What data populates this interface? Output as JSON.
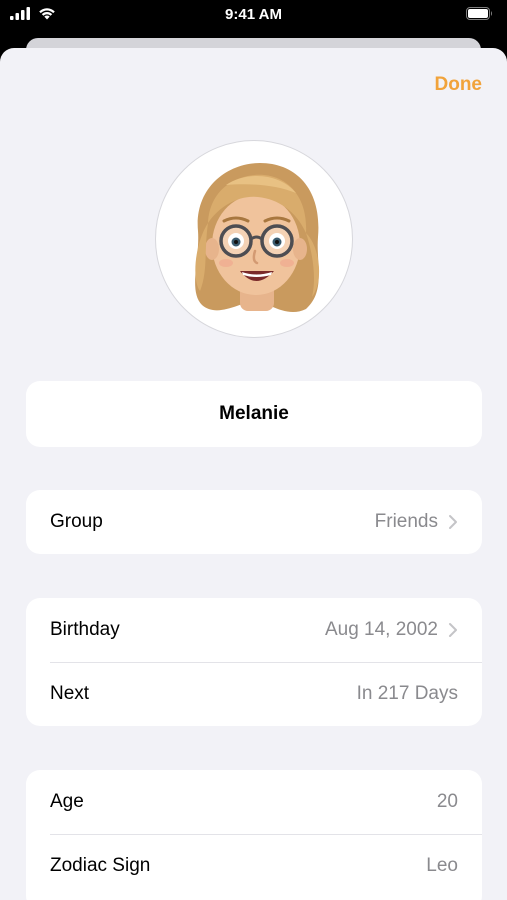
{
  "status_bar": {
    "time": "9:41 AM"
  },
  "header": {
    "done_label": "Done"
  },
  "profile": {
    "name": "Melanie"
  },
  "group": {
    "label": "Group",
    "value": "Friends"
  },
  "birthday": {
    "label": "Birthday",
    "value": "Aug 14, 2002"
  },
  "next": {
    "label": "Next",
    "value": "In 217 Days"
  },
  "age": {
    "label": "Age",
    "value": "20"
  },
  "zodiac": {
    "label": "Zodiac Sign",
    "value": "Leo"
  },
  "colors": {
    "accent": "#f1a33b",
    "background": "#f2f2f7",
    "secondary_text": "#8a8a8e"
  }
}
